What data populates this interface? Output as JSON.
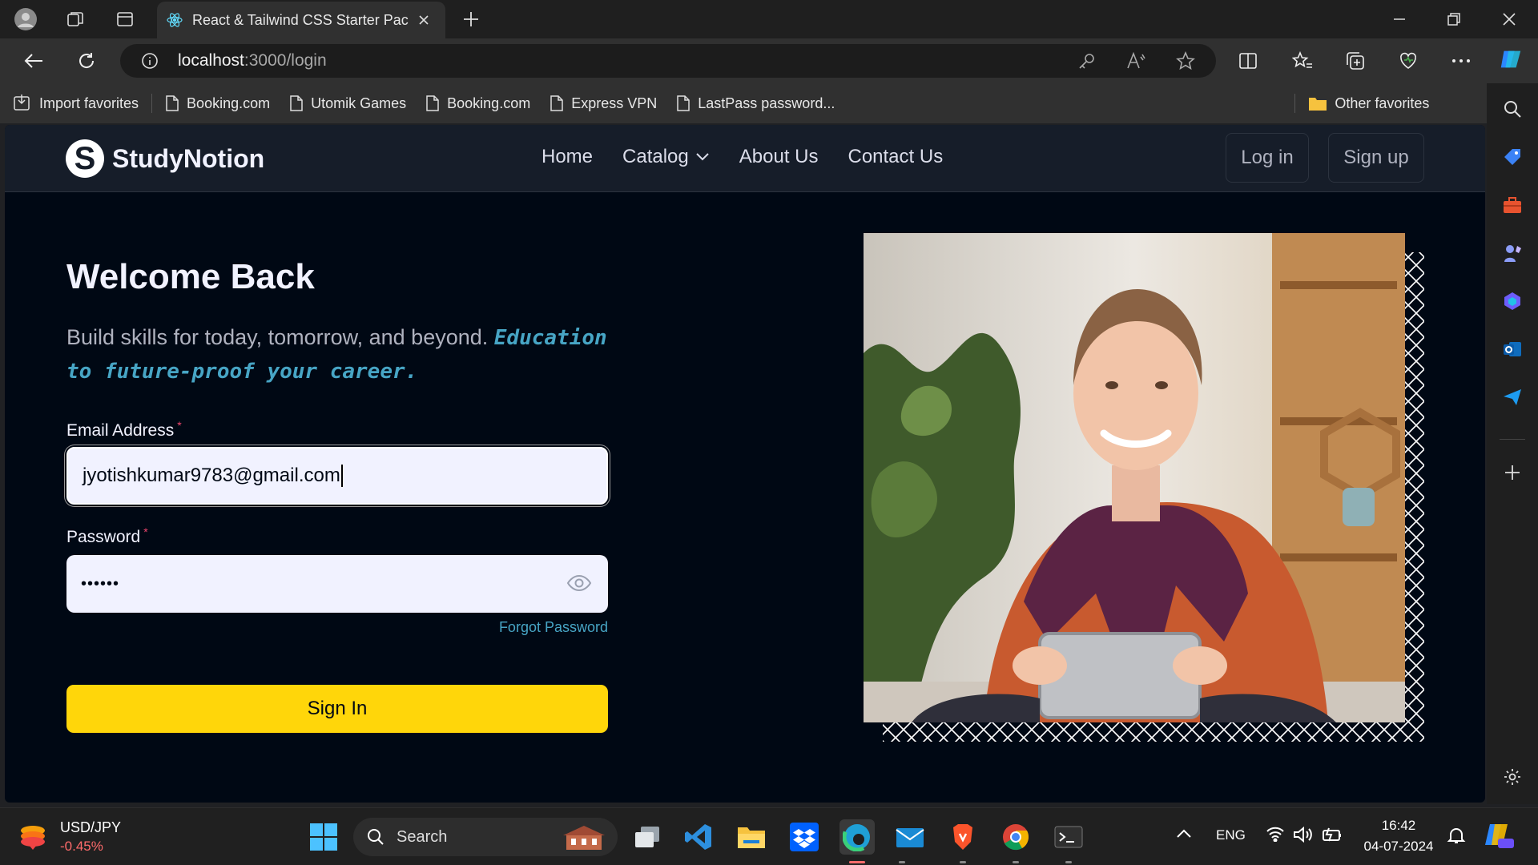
{
  "browser": {
    "tab_title": "React & Tailwind CSS Starter Pack",
    "url_host": "localhost",
    "url_path": ":3000/login",
    "favorites": [
      "Import favorites",
      "Booking.com",
      "Utomik Games",
      "Booking.com",
      "Express VPN",
      "LastPass password...",
      "Other favorites"
    ]
  },
  "site": {
    "logo_letter": "S",
    "logo_text": "StudyNotion",
    "nav": {
      "home": "Home",
      "catalog": "Catalog",
      "about": "About Us",
      "contact": "Contact Us"
    },
    "login_label": "Log in",
    "signup_label": "Sign up"
  },
  "login": {
    "title": "Welcome Back",
    "subtitle": "Build skills for today, tomorrow, and beyond.",
    "subtitle_highlight": "Education to future-proof your career.",
    "email_label": "Email Address",
    "email_value": "jyotishkumar9783@gmail.com",
    "password_label": "Password",
    "password_value": "••••••",
    "required_mark": "*",
    "forgot": "Forgot Password",
    "submit": "Sign In"
  },
  "taskbar": {
    "ticker_symbol": "USD/JPY",
    "ticker_change": "-0.45%",
    "search_label": "Search",
    "lang": "ENG",
    "time": "16:42",
    "date": "04-07-2024"
  },
  "colors": {
    "accent_yellow": "#FFD60A",
    "highlight_blue": "#47A5C5",
    "page_bg": "#000814",
    "nav_bg": "#161D29",
    "required_red": "#EF476F",
    "ticker_red": "#FF6B6B"
  }
}
